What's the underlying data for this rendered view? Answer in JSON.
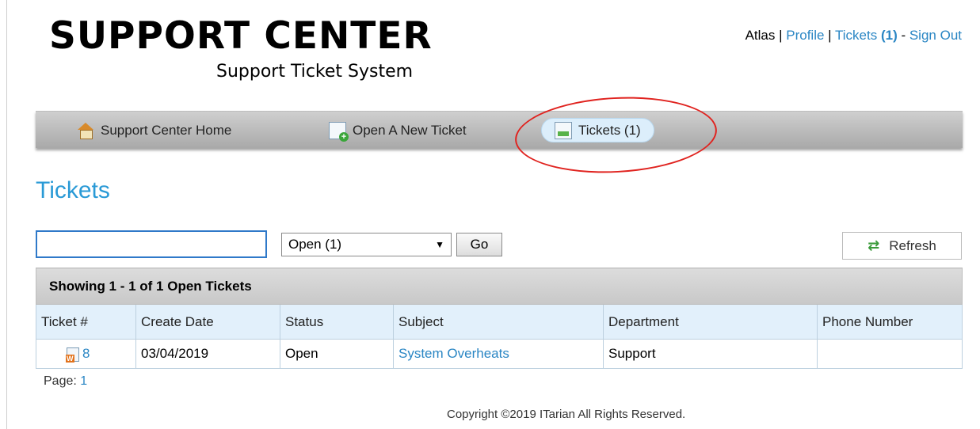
{
  "header": {
    "title": "SUPPORT CENTER",
    "subtitle": "Support Ticket System"
  },
  "user_nav": {
    "username": "Atlas",
    "sep1": " | ",
    "profile": "Profile",
    "sep2": " | ",
    "tickets": "Tickets",
    "tickets_count": "(1)",
    "sep3": " - ",
    "sign_out": "Sign Out"
  },
  "nav": {
    "items": [
      {
        "label": "Support Center Home",
        "icon": "home-icon"
      },
      {
        "label": "Open A New Ticket",
        "icon": "new-ticket-icon"
      },
      {
        "label": "Tickets (1)",
        "icon": "ticket-icon",
        "active": true
      }
    ]
  },
  "page": {
    "title": "Tickets"
  },
  "toolbar": {
    "search_value": "",
    "status_selected": "Open (1)",
    "go_label": "Go",
    "refresh_label": "Refresh"
  },
  "table": {
    "caption": "Showing  1 - 1 of 1 Open Tickets",
    "columns": [
      "Ticket #",
      "Create Date",
      "Status",
      "Subject",
      "Department",
      "Phone Number"
    ],
    "rows": [
      {
        "ticket": "8",
        "create_date": "03/04/2019",
        "status": "Open",
        "subject": "System Overheats",
        "department": "Support",
        "phone": ""
      }
    ]
  },
  "pager": {
    "label": "Page:",
    "current": "1"
  },
  "footer": {
    "copyright": "Copyright ©2019 ITarian All Rights Reserved."
  },
  "colors": {
    "link": "#2a86c4",
    "title_blue": "#2a9ad6",
    "annotation_red": "#e0231f"
  }
}
